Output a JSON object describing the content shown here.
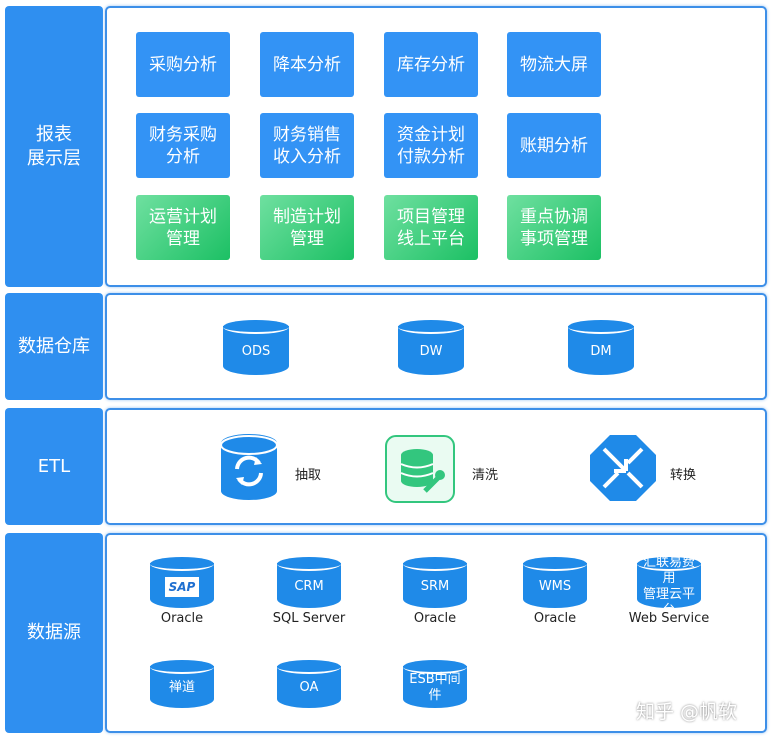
{
  "layers": [
    {
      "label": "报表\n展示层"
    },
    {
      "label": "数据仓库"
    },
    {
      "label": "ETL"
    },
    {
      "label": "数据源"
    }
  ],
  "reports": [
    {
      "text": "采购分析",
      "color": "blue"
    },
    {
      "text": "降本分析",
      "color": "blue"
    },
    {
      "text": "库存分析",
      "color": "blue"
    },
    {
      "text": "物流大屏",
      "color": "blue"
    },
    {
      "text": "财务采购\n分析",
      "color": "blue"
    },
    {
      "text": "财务销售\n收入分析",
      "color": "blue"
    },
    {
      "text": "资金计划\n付款分析",
      "color": "blue"
    },
    {
      "text": "账期分析",
      "color": "blue"
    },
    {
      "text": "运营计划\n管理",
      "color": "green"
    },
    {
      "text": "制造计划\n管理",
      "color": "green"
    },
    {
      "text": "项目管理\n线上平台",
      "color": "green"
    },
    {
      "text": "重点协调\n事项管理",
      "color": "green"
    }
  ],
  "warehouse": [
    "ODS",
    "DW",
    "DM"
  ],
  "etl": [
    {
      "label": "抽取",
      "icon": "refresh-database-icon"
    },
    {
      "label": "清洗",
      "icon": "database-wrench-icon"
    },
    {
      "label": "转换",
      "icon": "transform-arrows-icon"
    }
  ],
  "sources": [
    {
      "name": "SAP",
      "db": "Oracle"
    },
    {
      "name": "CRM",
      "db": "SQL Server"
    },
    {
      "name": "SRM",
      "db": "Oracle"
    },
    {
      "name": "WMS",
      "db": "Oracle"
    },
    {
      "name": "汇联易费用\n管理云平台",
      "db": "Web Service"
    },
    {
      "name": "禅道"
    },
    {
      "name": "OA"
    },
    {
      "name": "ESB中间件"
    }
  ],
  "watermark": "知乎 @帆软",
  "colors": {
    "blue": "#2f8ff0",
    "green": "#1cc064"
  }
}
